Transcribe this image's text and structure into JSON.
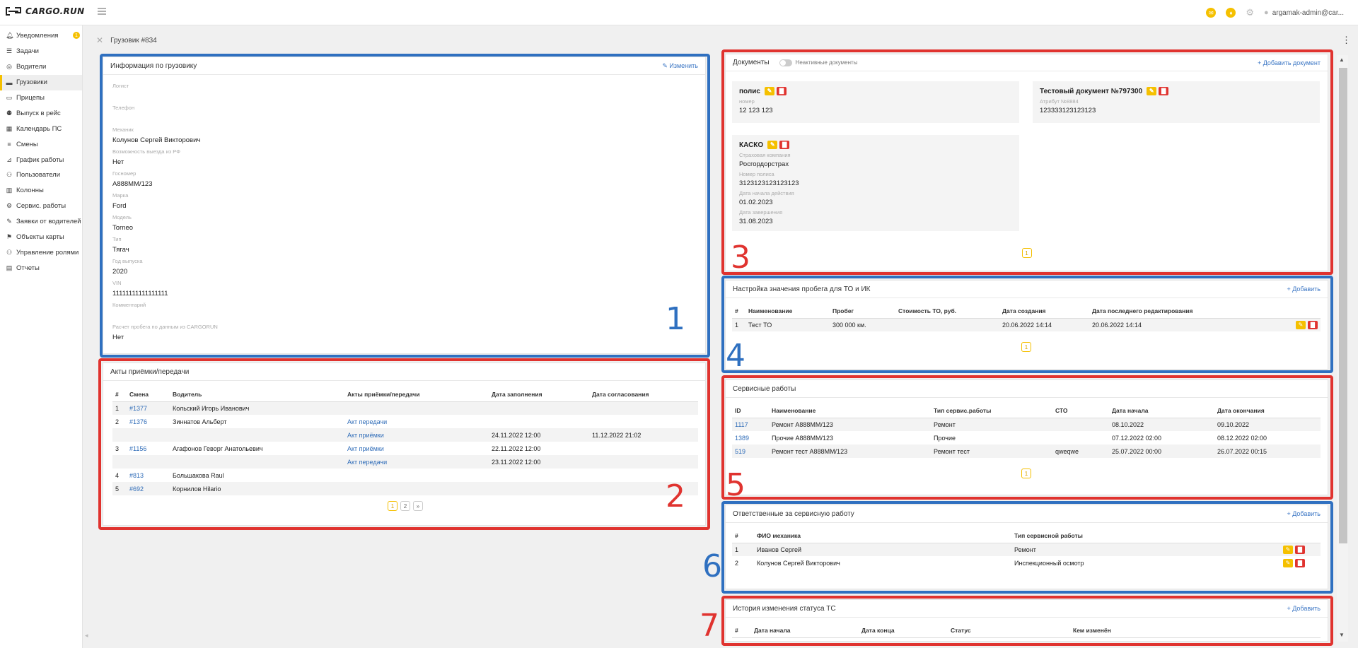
{
  "app": {
    "brand": "CARGO.RUN",
    "user": "argamak-admin@car...",
    "page_title": "Грузовик #834"
  },
  "sidebar": {
    "notifications_count": "1",
    "items": [
      {
        "label": "Уведомления",
        "icon": "bell-icon"
      },
      {
        "label": "Задачи",
        "icon": "list-icon"
      },
      {
        "label": "Водители",
        "icon": "steering-icon"
      },
      {
        "label": "Грузовики",
        "icon": "truck-icon"
      },
      {
        "label": "Прицепы",
        "icon": "trailer-icon"
      },
      {
        "label": "Выпуск в рейс",
        "icon": "departure-icon"
      },
      {
        "label": "Календарь ПС",
        "icon": "calendar-icon"
      },
      {
        "label": "Смены",
        "icon": "shifts-icon"
      },
      {
        "label": "График работы",
        "icon": "chart-icon"
      },
      {
        "label": "Пользователи",
        "icon": "users-icon"
      },
      {
        "label": "Колонны",
        "icon": "columns-icon"
      },
      {
        "label": "Сервис. работы",
        "icon": "service-icon"
      },
      {
        "label": "Заявки от водителей",
        "icon": "wrench-icon"
      },
      {
        "label": "Объекты карты",
        "icon": "map-objects-icon"
      },
      {
        "label": "Управление ролями",
        "icon": "roles-icon"
      },
      {
        "label": "Отчеты",
        "icon": "reports-icon"
      }
    ]
  },
  "info": {
    "title": "Информация по грузовику",
    "edit": "Изменить",
    "fields": [
      {
        "label": "Логист",
        "value": ""
      },
      {
        "label": "Телефон",
        "value": ""
      },
      {
        "label": "Механик",
        "value": "Колунов Сергей Викторович"
      },
      {
        "label": "Возможность выезда из РФ",
        "value": "Нет"
      },
      {
        "label": "Госномер",
        "value": "А888ММ/123"
      },
      {
        "label": "Марка",
        "value": "Ford"
      },
      {
        "label": "Модель",
        "value": "Torneo"
      },
      {
        "label": "Тип",
        "value": "Тягач"
      },
      {
        "label": "Год выпуска",
        "value": "2020"
      },
      {
        "label": "VIN",
        "value": "11111111111111111"
      },
      {
        "label": "Комментарий",
        "value": ""
      },
      {
        "label": "Расчет пробега по данным из CARGORUN",
        "value": "Нет"
      }
    ]
  },
  "acts": {
    "title": "Акты приёмки/передачи",
    "headers": [
      "#",
      "Смена",
      "Водитель",
      "Акты приёмки/передачи",
      "Дата заполнения",
      "Дата согласования"
    ],
    "rows": [
      {
        "n": "1",
        "shift": "#1377",
        "driver": "Кольский Игорь Иванович",
        "act": "",
        "filled": "",
        "approved": ""
      },
      {
        "n": "2",
        "shift": "#1376",
        "driver": "Зиннатов Альберт",
        "act": "Акт передачи",
        "filled": "",
        "approved": ""
      },
      {
        "n": "",
        "shift": "",
        "driver": "",
        "act": "Акт приёмки",
        "filled": "24.11.2022 12:00",
        "approved": "11.12.2022 21:02"
      },
      {
        "n": "3",
        "shift": "#1156",
        "driver": "Агафонов Геворг Анатольевич",
        "act": "Акт приёмки",
        "filled": "22.11.2022 12:00",
        "approved": ""
      },
      {
        "n": "",
        "shift": "",
        "driver": "",
        "act": "Акт передачи",
        "filled": "23.11.2022 12:00",
        "approved": ""
      },
      {
        "n": "4",
        "shift": "#813",
        "driver": "Большакова Raul",
        "act": "",
        "filled": "",
        "approved": ""
      },
      {
        "n": "5",
        "shift": "#692",
        "driver": "Корнилов Hilario",
        "act": "",
        "filled": "",
        "approved": ""
      }
    ],
    "pages": [
      "1",
      "2",
      "»"
    ]
  },
  "docs": {
    "title": "Документы",
    "inactive": "Неактивные документы",
    "add": "Добавить документ",
    "cards": [
      {
        "title": "полис",
        "fields": [
          {
            "label": "номер",
            "value": "12 123 123"
          }
        ]
      },
      {
        "title": "Тестовый документ №797300",
        "fields": [
          {
            "label": "Атрибут №8884",
            "value": "123333123123123"
          }
        ]
      },
      {
        "title": "КАСКО",
        "fields": [
          {
            "label": "Страховая компания",
            "value": "Росгордорстрах"
          },
          {
            "label": "Номер полиса",
            "value": "3123123123123123"
          },
          {
            "label": "Дата начала действия",
            "value": "01.02.2023"
          },
          {
            "label": "Дата завершения",
            "value": "31.08.2023"
          }
        ]
      }
    ],
    "page": "1"
  },
  "mileage": {
    "title": "Настройка значения пробега для ТО и ИК",
    "add": "Добавить",
    "headers": [
      "#",
      "Наименование",
      "Пробег",
      "Стоимость ТО, руб.",
      "Дата создания",
      "Дата последнего редактирования"
    ],
    "rows": [
      {
        "n": "1",
        "name": "Тест ТО",
        "mileage": "300 000 км.",
        "cost": "",
        "created": "20.06.2022 14:14",
        "edited": "20.06.2022 14:14"
      }
    ],
    "page": "1"
  },
  "service": {
    "title": "Сервисные работы",
    "headers": [
      "ID",
      "Наименование",
      "Тип сервис.работы",
      "СТО",
      "Дата начала",
      "Дата окончания"
    ],
    "rows": [
      {
        "id": "1117",
        "name": "Ремонт А888ММ/123",
        "type": "Ремонт",
        "sto": "",
        "start": "08.10.2022",
        "end": "09.10.2022"
      },
      {
        "id": "1389",
        "name": "Прочие А888ММ/123",
        "type": "Прочие",
        "sto": "",
        "start": "07.12.2022 02:00",
        "end": "08.12.2022 02:00"
      },
      {
        "id": "519",
        "name": "Ремонт тест А888ММ/123",
        "type": "Ремонт тест",
        "sto": "qweqwe",
        "start": "25.07.2022 00:00",
        "end": "26.07.2022 00:15"
      }
    ],
    "page": "1"
  },
  "responsible": {
    "title": "Ответственные за сервисную работу",
    "add": "Добавить",
    "headers": [
      "#",
      "ФИО механика",
      "Тип сервисной работы"
    ],
    "rows": [
      {
        "n": "1",
        "name": "Иванов Сергей",
        "type": "Ремонт"
      },
      {
        "n": "2",
        "name": "Колунов Сергей Викторович",
        "type": "Инспекционный осмотр"
      }
    ]
  },
  "history": {
    "title": "История изменения статуса ТС",
    "add": "Добавить",
    "headers": [
      "#",
      "Дата начала",
      "Дата конца",
      "Статус",
      "Кем изменён"
    ]
  },
  "annotations": [
    "1",
    "2",
    "3",
    "4",
    "5",
    "6",
    "7"
  ],
  "colors": {
    "accent": "#f5c000",
    "danger": "#e0332f",
    "link": "#2f6cb8",
    "annotation_blue": "#2f70c0",
    "annotation_red": "#e0332f"
  }
}
